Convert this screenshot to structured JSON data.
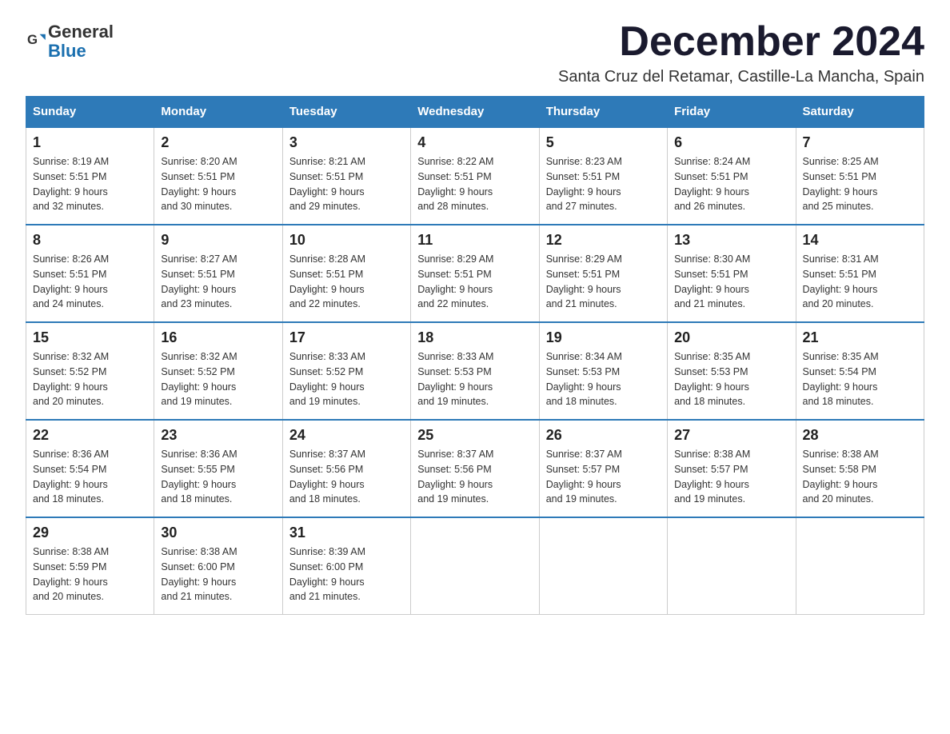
{
  "header": {
    "logo_general": "General",
    "logo_blue": "Blue",
    "month_title": "December 2024",
    "location": "Santa Cruz del Retamar, Castille-La Mancha, Spain"
  },
  "weekdays": [
    "Sunday",
    "Monday",
    "Tuesday",
    "Wednesday",
    "Thursday",
    "Friday",
    "Saturday"
  ],
  "weeks": [
    [
      {
        "day": "1",
        "sunrise": "8:19 AM",
        "sunset": "5:51 PM",
        "daylight": "9 hours and 32 minutes."
      },
      {
        "day": "2",
        "sunrise": "8:20 AM",
        "sunset": "5:51 PM",
        "daylight": "9 hours and 30 minutes."
      },
      {
        "day": "3",
        "sunrise": "8:21 AM",
        "sunset": "5:51 PM",
        "daylight": "9 hours and 29 minutes."
      },
      {
        "day": "4",
        "sunrise": "8:22 AM",
        "sunset": "5:51 PM",
        "daylight": "9 hours and 28 minutes."
      },
      {
        "day": "5",
        "sunrise": "8:23 AM",
        "sunset": "5:51 PM",
        "daylight": "9 hours and 27 minutes."
      },
      {
        "day": "6",
        "sunrise": "8:24 AM",
        "sunset": "5:51 PM",
        "daylight": "9 hours and 26 minutes."
      },
      {
        "day": "7",
        "sunrise": "8:25 AM",
        "sunset": "5:51 PM",
        "daylight": "9 hours and 25 minutes."
      }
    ],
    [
      {
        "day": "8",
        "sunrise": "8:26 AM",
        "sunset": "5:51 PM",
        "daylight": "9 hours and 24 minutes."
      },
      {
        "day": "9",
        "sunrise": "8:27 AM",
        "sunset": "5:51 PM",
        "daylight": "9 hours and 23 minutes."
      },
      {
        "day": "10",
        "sunrise": "8:28 AM",
        "sunset": "5:51 PM",
        "daylight": "9 hours and 22 minutes."
      },
      {
        "day": "11",
        "sunrise": "8:29 AM",
        "sunset": "5:51 PM",
        "daylight": "9 hours and 22 minutes."
      },
      {
        "day": "12",
        "sunrise": "8:29 AM",
        "sunset": "5:51 PM",
        "daylight": "9 hours and 21 minutes."
      },
      {
        "day": "13",
        "sunrise": "8:30 AM",
        "sunset": "5:51 PM",
        "daylight": "9 hours and 21 minutes."
      },
      {
        "day": "14",
        "sunrise": "8:31 AM",
        "sunset": "5:51 PM",
        "daylight": "9 hours and 20 minutes."
      }
    ],
    [
      {
        "day": "15",
        "sunrise": "8:32 AM",
        "sunset": "5:52 PM",
        "daylight": "9 hours and 20 minutes."
      },
      {
        "day": "16",
        "sunrise": "8:32 AM",
        "sunset": "5:52 PM",
        "daylight": "9 hours and 19 minutes."
      },
      {
        "day": "17",
        "sunrise": "8:33 AM",
        "sunset": "5:52 PM",
        "daylight": "9 hours and 19 minutes."
      },
      {
        "day": "18",
        "sunrise": "8:33 AM",
        "sunset": "5:53 PM",
        "daylight": "9 hours and 19 minutes."
      },
      {
        "day": "19",
        "sunrise": "8:34 AM",
        "sunset": "5:53 PM",
        "daylight": "9 hours and 18 minutes."
      },
      {
        "day": "20",
        "sunrise": "8:35 AM",
        "sunset": "5:53 PM",
        "daylight": "9 hours and 18 minutes."
      },
      {
        "day": "21",
        "sunrise": "8:35 AM",
        "sunset": "5:54 PM",
        "daylight": "9 hours and 18 minutes."
      }
    ],
    [
      {
        "day": "22",
        "sunrise": "8:36 AM",
        "sunset": "5:54 PM",
        "daylight": "9 hours and 18 minutes."
      },
      {
        "day": "23",
        "sunrise": "8:36 AM",
        "sunset": "5:55 PM",
        "daylight": "9 hours and 18 minutes."
      },
      {
        "day": "24",
        "sunrise": "8:37 AM",
        "sunset": "5:56 PM",
        "daylight": "9 hours and 18 minutes."
      },
      {
        "day": "25",
        "sunrise": "8:37 AM",
        "sunset": "5:56 PM",
        "daylight": "9 hours and 19 minutes."
      },
      {
        "day": "26",
        "sunrise": "8:37 AM",
        "sunset": "5:57 PM",
        "daylight": "9 hours and 19 minutes."
      },
      {
        "day": "27",
        "sunrise": "8:38 AM",
        "sunset": "5:57 PM",
        "daylight": "9 hours and 19 minutes."
      },
      {
        "day": "28",
        "sunrise": "8:38 AM",
        "sunset": "5:58 PM",
        "daylight": "9 hours and 20 minutes."
      }
    ],
    [
      {
        "day": "29",
        "sunrise": "8:38 AM",
        "sunset": "5:59 PM",
        "daylight": "9 hours and 20 minutes."
      },
      {
        "day": "30",
        "sunrise": "8:38 AM",
        "sunset": "6:00 PM",
        "daylight": "9 hours and 21 minutes."
      },
      {
        "day": "31",
        "sunrise": "8:39 AM",
        "sunset": "6:00 PM",
        "daylight": "9 hours and 21 minutes."
      },
      null,
      null,
      null,
      null
    ]
  ],
  "labels": {
    "sunrise": "Sunrise:",
    "sunset": "Sunset:",
    "daylight": "Daylight:"
  }
}
